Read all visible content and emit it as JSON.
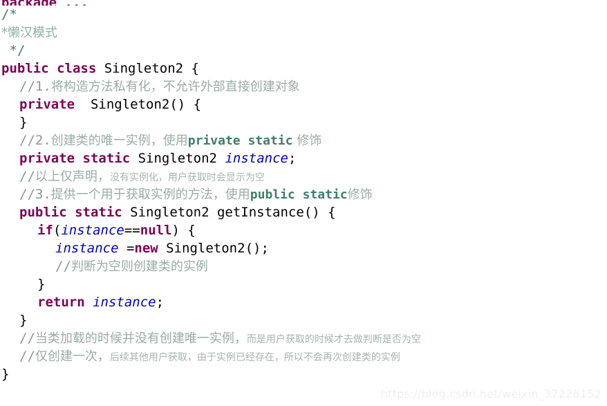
{
  "editor": {
    "language": "java",
    "background_color": "#ffffff",
    "colors": {
      "keyword": "#7f0055",
      "plain_text": "#000000",
      "comment": "#8a9a92",
      "comment_keyword": "#3f7d6e",
      "field_variable": "#0000c0",
      "watermark": "#eef1f0"
    },
    "lines": [
      {
        "id": "l0",
        "clipped": true,
        "indent": 0,
        "segments": [
          {
            "text": "package ...",
            "style": "kw"
          }
        ]
      },
      {
        "id": "l1",
        "indent": 0,
        "segments": [
          {
            "text": "/*",
            "style": "blockcmt"
          }
        ]
      },
      {
        "id": "l2",
        "indent": 0,
        "segments": [
          {
            "text": "*懒汉模式",
            "style": "blockcmt-zh"
          }
        ]
      },
      {
        "id": "l3",
        "indent": 0,
        "segments": [
          {
            "text": " */",
            "style": "blockcmt"
          }
        ]
      },
      {
        "id": "l4",
        "indent": 0,
        "segments": [
          {
            "text": "public class",
            "style": "kw"
          },
          {
            "text": " Singleton2 {",
            "style": "plain"
          }
        ]
      },
      {
        "id": "l5",
        "indent": 1,
        "segments": [
          {
            "text": "//1.",
            "style": "cmt"
          },
          {
            "text": "将构造方法私有化，不允许外部直接创建对象",
            "style": "cmt-zh"
          }
        ]
      },
      {
        "id": "l6",
        "indent": 1,
        "segments": [
          {
            "text": "private",
            "style": "kw"
          },
          {
            "text": "  Singleton2() {",
            "style": "plain"
          }
        ]
      },
      {
        "id": "l7",
        "indent": 1,
        "segments": [
          {
            "text": "}",
            "style": "plain"
          }
        ]
      },
      {
        "id": "l8",
        "indent": 1,
        "segments": [
          {
            "text": "//2.",
            "style": "cmt"
          },
          {
            "text": "创建类的唯一实例，使用",
            "style": "cmt-zh"
          },
          {
            "text": "private static",
            "style": "cmt-kw"
          },
          {
            "text": " 修饰",
            "style": "cmt-zh"
          }
        ]
      },
      {
        "id": "l9",
        "indent": 1,
        "segments": [
          {
            "text": "private static",
            "style": "kw"
          },
          {
            "text": " Singleton2 ",
            "style": "plain"
          },
          {
            "text": "instance",
            "style": "field"
          },
          {
            "text": ";",
            "style": "plain"
          }
        ]
      },
      {
        "id": "l10",
        "indent": 1,
        "segments": [
          {
            "text": "//",
            "style": "cmt"
          },
          {
            "text": "以上仅声明，",
            "style": "cmt-zh"
          },
          {
            "text": "没有实例化，用户获取时会显示为空",
            "style": "cmt-zh-sm"
          }
        ]
      },
      {
        "id": "l11",
        "indent": 1,
        "segments": [
          {
            "text": "//3.",
            "style": "cmt"
          },
          {
            "text": "提供一个用于获取实例的方法，使用",
            "style": "cmt-zh"
          },
          {
            "text": "public static",
            "style": "cmt-kw"
          },
          {
            "text": "修饰",
            "style": "cmt-zh"
          }
        ]
      },
      {
        "id": "l12",
        "indent": 1,
        "segments": [
          {
            "text": "public static",
            "style": "kw"
          },
          {
            "text": " Singleton2 getInstance() {",
            "style": "plain"
          }
        ]
      },
      {
        "id": "l13",
        "indent": 2,
        "segments": [
          {
            "text": "if",
            "style": "kw"
          },
          {
            "text": "(",
            "style": "plain"
          },
          {
            "text": "instance",
            "style": "field"
          },
          {
            "text": "==",
            "style": "plain"
          },
          {
            "text": "null",
            "style": "kw"
          },
          {
            "text": ") {",
            "style": "plain"
          }
        ]
      },
      {
        "id": "l14",
        "indent": 3,
        "segments": [
          {
            "text": "instance",
            "style": "field"
          },
          {
            "text": " =",
            "style": "plain"
          },
          {
            "text": "new",
            "style": "kw"
          },
          {
            "text": " Singleton2();",
            "style": "plain"
          }
        ]
      },
      {
        "id": "l15",
        "indent": 3,
        "segments": [
          {
            "text": "//",
            "style": "cmt"
          },
          {
            "text": "判断为空则创建类的实例",
            "style": "cmt-zh"
          }
        ]
      },
      {
        "id": "l16",
        "indent": 2,
        "segments": [
          {
            "text": "}",
            "style": "plain"
          }
        ]
      },
      {
        "id": "l17",
        "indent": 2,
        "segments": [
          {
            "text": "return",
            "style": "kw"
          },
          {
            "text": " ",
            "style": "plain"
          },
          {
            "text": "instance",
            "style": "field"
          },
          {
            "text": ";",
            "style": "plain"
          }
        ]
      },
      {
        "id": "l18",
        "indent": 1,
        "segments": [
          {
            "text": "}",
            "style": "plain"
          }
        ]
      },
      {
        "id": "l19",
        "indent": 1,
        "segments": [
          {
            "text": "//",
            "style": "cmt"
          },
          {
            "text": "当类加载的时候并没有创建唯一实例，",
            "style": "cmt-zh"
          },
          {
            "text": "而是用户获取的时候才去做判断是否为空",
            "style": "cmt-zh-sm"
          }
        ]
      },
      {
        "id": "l20",
        "indent": 1,
        "segments": [
          {
            "text": "//",
            "style": "cmt"
          },
          {
            "text": "仅创建一次，",
            "style": "cmt-zh"
          },
          {
            "text": "后续其他用户获取，由于实例已经存在，所以不会再次创建类的实例",
            "style": "cmt-zh-sm"
          }
        ]
      },
      {
        "id": "l21",
        "indent": 0,
        "segments": [
          {
            "text": "}",
            "style": "plain"
          }
        ]
      }
    ]
  },
  "watermark": {
    "text": "https://blog.csdn.net/weixin_37228152"
  }
}
